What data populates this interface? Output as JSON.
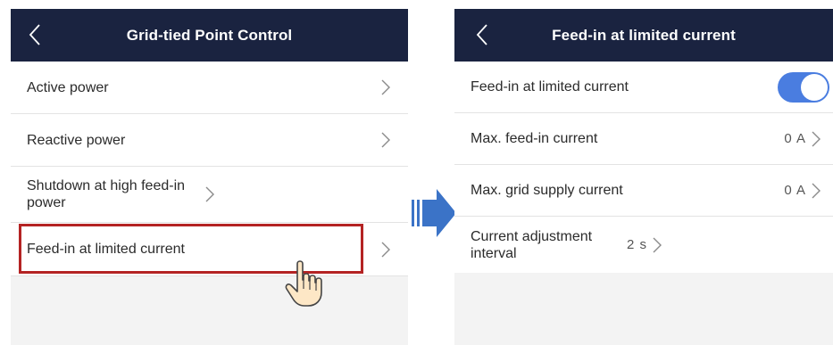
{
  "left": {
    "title": "Grid-tied Point Control",
    "back_icon": "chevron-left-icon",
    "items": [
      {
        "label": "Active power"
      },
      {
        "label": "Reactive power"
      },
      {
        "label": "Shutdown at high feed-in power"
      },
      {
        "label": "Feed-in at limited current"
      }
    ],
    "highlight_color": "#b42323"
  },
  "right": {
    "title": "Feed-in at limited current",
    "back_icon": "chevron-left-icon",
    "toggle_row": {
      "label": "Feed-in at limited current",
      "toggle_on": true,
      "toggle_color": "#4a7de0"
    },
    "rows": [
      {
        "label": "Max. feed-in current",
        "value": "0 A"
      },
      {
        "label": "Max. grid supply current",
        "value": "0 A"
      },
      {
        "label": "Current adjustment interval",
        "value": "2 s"
      }
    ]
  },
  "colors": {
    "nav_bg": "#1a2340",
    "arrow": "#3b73c7",
    "screen_bg": "#f3f3f3"
  },
  "icons": {
    "transition_arrow": "right-arrow-icon",
    "pointer": "hand-pointer-icon",
    "row_chevron": "chevron-right-icon"
  }
}
